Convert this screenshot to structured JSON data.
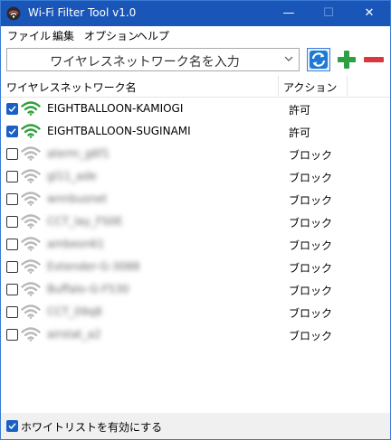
{
  "window": {
    "title": "Wi-Fi Filter Tool v1.0",
    "minimize": "—",
    "maximize": "☐",
    "close": "✕"
  },
  "menu": [
    "ファイル",
    "編集",
    "オプション",
    "ヘルプ"
  ],
  "toolbar": {
    "ssid_placeholder": "ワイヤレスネットワーク名を入力"
  },
  "columns": {
    "name": "ワイヤレスネットワーク名",
    "action": "アクション"
  },
  "networks": [
    {
      "checked": true,
      "ssid": "EIGHTBALLOON-KAMIOGI",
      "action": "許可",
      "obscured": false
    },
    {
      "checked": true,
      "ssid": "EIGHTBALLOON-SUGINAMI",
      "action": "許可",
      "obscured": false
    },
    {
      "checked": false,
      "ssid": "aterm_g6f1",
      "action": "ブロック",
      "obscured": true
    },
    {
      "checked": false,
      "ssid": "gl11_ade",
      "action": "ブロック",
      "obscured": true
    },
    {
      "checked": false,
      "ssid": "wnnbusnet",
      "action": "ブロック",
      "obscured": true
    },
    {
      "checked": false,
      "ssid": "CCT_lay_FS0E",
      "action": "ブロック",
      "obscured": true
    },
    {
      "checked": false,
      "ssid": "ambesn61",
      "action": "ブロック",
      "obscured": true
    },
    {
      "checked": false,
      "ssid": "Extender-G-3088",
      "action": "ブロック",
      "obscured": true
    },
    {
      "checked": false,
      "ssid": "Buffalo-G-F530",
      "action": "ブロック",
      "obscured": true
    },
    {
      "checked": false,
      "ssid": "CCT_09q8",
      "action": "ブロック",
      "obscured": true
    },
    {
      "checked": false,
      "ssid": "airstat_a2",
      "action": "ブロック",
      "obscured": true
    }
  ],
  "footer": {
    "whitelist_label": "ホワイトリストを有効にする",
    "whitelist_checked": true
  },
  "colors": {
    "titlebar": "#1a56b8",
    "wifi_on": "#2e9e3a",
    "wifi_off": "#b8b8b8",
    "add": "#2ea043",
    "remove": "#d9363e"
  }
}
